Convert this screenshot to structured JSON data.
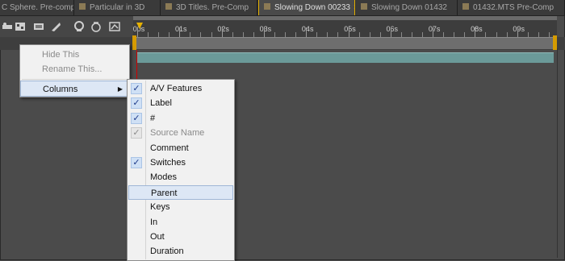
{
  "tabs": [
    {
      "label": "C Sphere. Pre-comp",
      "active": false,
      "closable": false
    },
    {
      "label": "Particular in 3D",
      "active": false,
      "closable": false
    },
    {
      "label": "3D Titles. Pre-Comp",
      "active": false,
      "closable": false
    },
    {
      "label": "Slowing Down 00233",
      "active": true,
      "closable": true
    },
    {
      "label": "Slowing Down 01432",
      "active": false,
      "closable": false
    },
    {
      "label": "01432.MTS Pre-Comp",
      "active": false,
      "closable": false
    }
  ],
  "close_glyph": "×",
  "ruler": {
    "labels": [
      "00s",
      "01s",
      "02s",
      "03s",
      "04s",
      "05s",
      "06s",
      "07s",
      "08s",
      "09s"
    ]
  },
  "context_menu": {
    "items": [
      {
        "label": "Hide This",
        "enabled": false
      },
      {
        "label": "Rename This...",
        "enabled": false
      },
      {
        "label": "Columns",
        "enabled": true,
        "submenu": true,
        "highlighted": true
      }
    ],
    "arrow_glyph": "▶"
  },
  "columns_menu": {
    "check_glyph": "✓",
    "items": [
      {
        "label": "A/V Features",
        "checked": true,
        "enabled": true
      },
      {
        "label": "Label",
        "checked": true,
        "enabled": true
      },
      {
        "label": "#",
        "checked": true,
        "enabled": true
      },
      {
        "label": "Source Name",
        "checked": true,
        "enabled": false
      },
      {
        "label": "Comment",
        "checked": false,
        "enabled": true
      },
      {
        "label": "Switches",
        "checked": true,
        "enabled": true
      },
      {
        "label": "Modes",
        "checked": false,
        "enabled": true
      },
      {
        "label": "Parent",
        "checked": false,
        "enabled": true,
        "highlighted": true
      },
      {
        "label": "Keys",
        "checked": false,
        "enabled": true
      },
      {
        "label": "In",
        "checked": false,
        "enabled": true
      },
      {
        "label": "Out",
        "checked": false,
        "enabled": true
      },
      {
        "label": "Duration",
        "checked": false,
        "enabled": true
      }
    ]
  },
  "colors": {
    "active_tab_outline": "#e6b100",
    "layer_bar": "#6b9a99",
    "playhead": "#d00000",
    "check_bg": "#cfe0f5",
    "menu_highlight": "#dde7f5"
  }
}
